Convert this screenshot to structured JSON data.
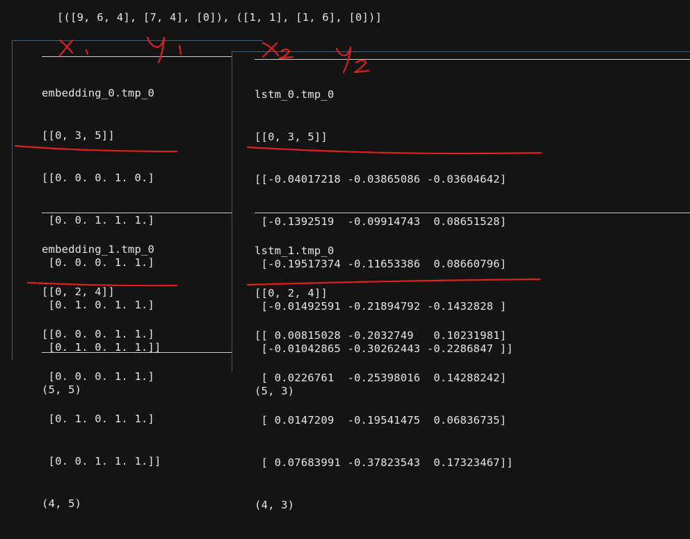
{
  "header_output": "[([9, 6, 4], [7, 4], [0]), ([1, 1], [1, 6], [0])]",
  "left_blocks": [
    {
      "name": "embedding_0.tmp_0",
      "lines": [
        "[[0, 3, 5]]",
        "[[0. 0. 0. 1. 0.]",
        " [0. 0. 1. 1. 1.]",
        " [0. 0. 0. 1. 1.]",
        " [0. 1. 0. 1. 1.]",
        " [0. 1. 0. 1. 1.]]",
        "(5, 5)"
      ]
    },
    {
      "name": "embedding_1.tmp_0",
      "lines": [
        "[[0, 2, 4]]",
        "[[0. 0. 0. 1. 1.]",
        " [0. 0. 0. 1. 1.]",
        " [0. 1. 0. 1. 1.]",
        " [0. 0. 1. 1. 1.]]",
        "(4, 5)"
      ]
    }
  ],
  "right_blocks": [
    {
      "name": "lstm_0.tmp_0",
      "lines": [
        "[[0, 3, 5]]",
        "[[-0.04017218 -0.03865086 -0.03604642]",
        " [-0.1392519  -0.09914743  0.08651528]",
        " [-0.19517374 -0.11653386  0.08660796]",
        " [-0.01492591 -0.21894792 -0.1432828 ]",
        " [-0.01042865 -0.30262443 -0.2286847 ]]",
        "(5, 3)"
      ]
    },
    {
      "name": "lstm_1.tmp_0",
      "lines": [
        "[[0, 2, 4]]",
        "[[ 0.00815028 -0.2032749   0.10231981]",
        " [ 0.0226761  -0.25398016  0.14288242]",
        " [ 0.0147209  -0.19541475  0.06836735]",
        " [ 0.07683991 -0.37823543  0.17323467]]",
        "(4, 3)"
      ]
    }
  ],
  "colors": {
    "background": "#141414",
    "text": "#e6e6e6",
    "annotation": "#e02020",
    "panel_border": "#3a5f80"
  }
}
